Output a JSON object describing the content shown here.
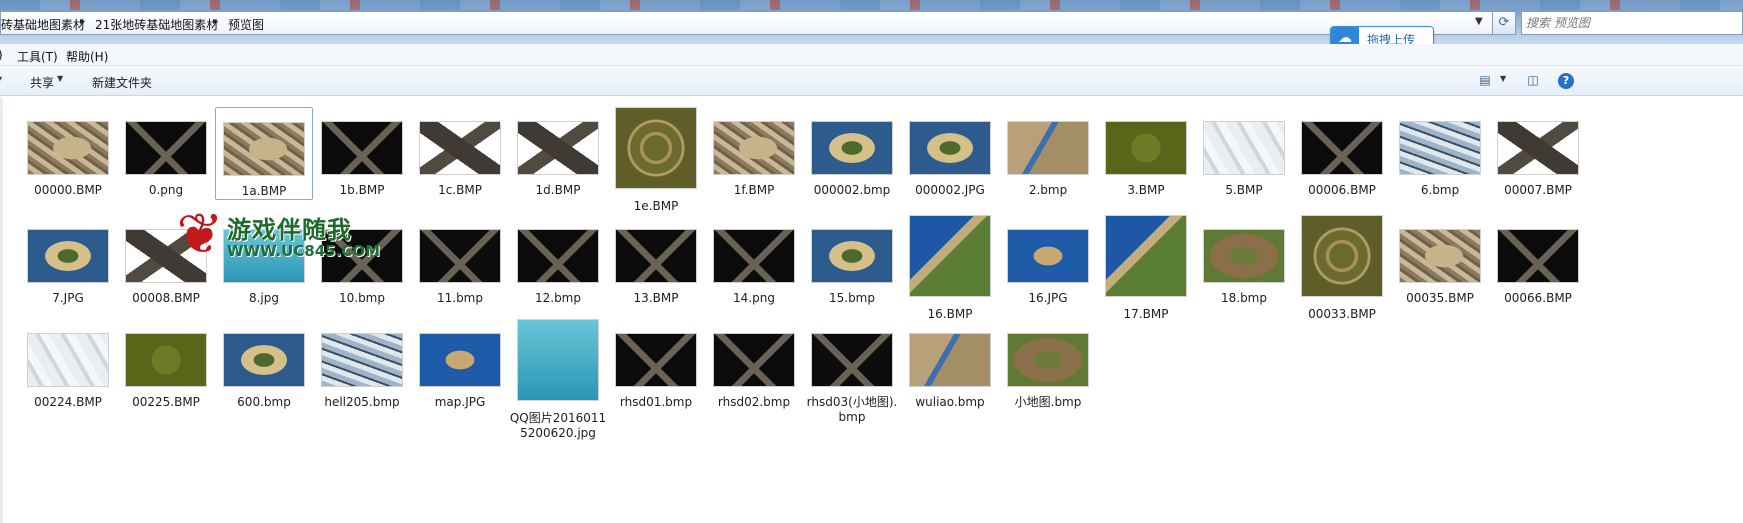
{
  "address": {
    "breadcrumbs": [
      "砖基础地图素材",
      "21张地砖基础地图素材",
      "预览图"
    ],
    "search_placeholder": "搜索 预览图"
  },
  "upload_button": {
    "label": "拖拽上传",
    "icon": "cloud-upload-icon"
  },
  "menu": {
    "items": [
      "具(T)",
      "工具(T)",
      "帮助(H)"
    ]
  },
  "toolbar": {
    "share_label": "共享",
    "new_folder_label": "新建文件夹",
    "help_label": "?"
  },
  "watermark": {
    "title": "游戏伴随我",
    "url": "WWW.UC845.COM"
  },
  "files": [
    {
      "name": "00000.BMP",
      "style": "t-sand"
    },
    {
      "name": "0.png",
      "style": "t-diamond"
    },
    {
      "name": "1a.BMP",
      "style": "t-sand",
      "selected": true
    },
    {
      "name": "1b.BMP",
      "style": "t-diamond"
    },
    {
      "name": "1c.BMP",
      "style": "t-white-diamond"
    },
    {
      "name": "1d.BMP",
      "style": "t-white-diamond"
    },
    {
      "name": "1e.BMP",
      "style": "t-green-oval",
      "tall": true
    },
    {
      "name": "1f.BMP",
      "style": "t-sand"
    },
    {
      "name": "000002.bmp",
      "style": "t-island"
    },
    {
      "name": "000002.JPG",
      "style": "t-island"
    },
    {
      "name": "2.bmp",
      "style": "t-river"
    },
    {
      "name": "3.BMP",
      "style": "t-grass"
    },
    {
      "name": "5.BMP",
      "style": "t-snow"
    },
    {
      "name": "00006.BMP",
      "style": "t-diamond"
    },
    {
      "name": "6.bmp",
      "style": "t-ice"
    },
    {
      "name": "00007.BMP",
      "style": "t-white-diamond"
    },
    {
      "name": "7.JPG",
      "style": "t-island"
    },
    {
      "name": "00008.BMP",
      "style": "t-white-diamond"
    },
    {
      "name": "8.jpg",
      "style": "t-pool"
    },
    {
      "name": "10.bmp",
      "style": "t-diamond"
    },
    {
      "name": "11.bmp",
      "style": "t-diamond"
    },
    {
      "name": "12.bmp",
      "style": "t-diamond"
    },
    {
      "name": "13.BMP",
      "style": "t-diamond"
    },
    {
      "name": "14.png",
      "style": "t-diamond"
    },
    {
      "name": "15.bmp",
      "style": "t-island"
    },
    {
      "name": "16.BMP",
      "style": "t-coast",
      "tall": true
    },
    {
      "name": "16.JPG",
      "style": "t-ocean-plat"
    },
    {
      "name": "17.BMP",
      "style": "t-coast",
      "tall": true
    },
    {
      "name": "18.bmp",
      "style": "t-dirt-green"
    },
    {
      "name": "00033.BMP",
      "style": "t-green-oval",
      "tall": true
    },
    {
      "name": "00035.BMP",
      "style": "t-sand"
    },
    {
      "name": "00066.BMP",
      "style": "t-diamond"
    },
    {
      "name": "00224.BMP",
      "style": "t-snow"
    },
    {
      "name": "00225.BMP",
      "style": "t-grass"
    },
    {
      "name": "600.bmp",
      "style": "t-island"
    },
    {
      "name": "hell205.bmp",
      "style": "t-ice"
    },
    {
      "name": "map.JPG",
      "style": "t-ocean-plat"
    },
    {
      "name": "QQ图片20160115200620.jpg",
      "style": "t-pool",
      "tall": true
    },
    {
      "name": "rhsd01.bmp",
      "style": "t-diamond"
    },
    {
      "name": "rhsd02.bmp",
      "style": "t-diamond"
    },
    {
      "name": "rhsd03(小地图).bmp",
      "style": "t-diamond"
    },
    {
      "name": "wuliao.bmp",
      "style": "t-river"
    },
    {
      "name": "小地图.bmp",
      "style": "t-dirt-green"
    }
  ]
}
